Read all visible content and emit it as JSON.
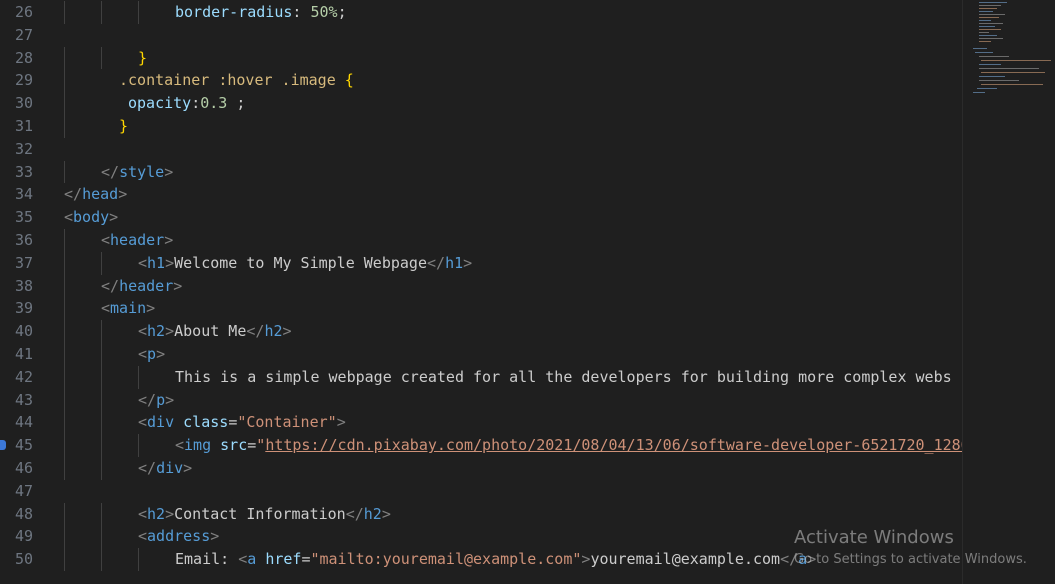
{
  "editor": {
    "lines": [
      {
        "n": "26",
        "indent": 3,
        "tokens": [
          {
            "c": "tok-prop",
            "t": "border-radius"
          },
          {
            "c": "tok-text",
            "t": ": "
          },
          {
            "c": "tok-num",
            "t": "50%"
          },
          {
            "c": "tok-text",
            "t": ";"
          }
        ]
      },
      {
        "n": "27",
        "indent": 0,
        "tokens": []
      },
      {
        "n": "28",
        "indent": 2,
        "tokens": [
          {
            "c": "tok-brace",
            "t": "}"
          }
        ]
      },
      {
        "n": "29",
        "indent": 1,
        "pad": "  ",
        "tokens": [
          {
            "c": "tok-sel",
            "t": ".container :hover .image "
          },
          {
            "c": "tok-brace",
            "t": "{"
          }
        ]
      },
      {
        "n": "30",
        "indent": 1,
        "pad": "   ",
        "tokens": [
          {
            "c": "tok-prop",
            "t": "opacity"
          },
          {
            "c": "tok-text",
            "t": ":"
          },
          {
            "c": "tok-num",
            "t": "0.3"
          },
          {
            "c": "tok-text",
            "t": " ;"
          }
        ]
      },
      {
        "n": "31",
        "indent": 1,
        "pad": "  ",
        "tokens": [
          {
            "c": "tok-brace",
            "t": "}"
          }
        ]
      },
      {
        "n": "32",
        "indent": 0,
        "tokens": []
      },
      {
        "n": "33",
        "indent": 1,
        "tokens": [
          {
            "c": "tok-bracket",
            "t": "</"
          },
          {
            "c": "tok-tag",
            "t": "style"
          },
          {
            "c": "tok-bracket",
            "t": ">"
          }
        ]
      },
      {
        "n": "34",
        "indent": 0,
        "tokens": [
          {
            "c": "tok-bracket",
            "t": "</"
          },
          {
            "c": "tok-tag",
            "t": "head"
          },
          {
            "c": "tok-bracket",
            "t": ">"
          }
        ]
      },
      {
        "n": "35",
        "indent": 0,
        "tokens": [
          {
            "c": "tok-bracket",
            "t": "<"
          },
          {
            "c": "tok-tag",
            "t": "body"
          },
          {
            "c": "tok-bracket",
            "t": ">"
          }
        ]
      },
      {
        "n": "36",
        "indent": 1,
        "tokens": [
          {
            "c": "tok-bracket",
            "t": "<"
          },
          {
            "c": "tok-tag",
            "t": "header"
          },
          {
            "c": "tok-bracket",
            "t": ">"
          }
        ]
      },
      {
        "n": "37",
        "indent": 2,
        "tokens": [
          {
            "c": "tok-bracket",
            "t": "<"
          },
          {
            "c": "tok-tag",
            "t": "h1"
          },
          {
            "c": "tok-bracket",
            "t": ">"
          },
          {
            "c": "tok-text",
            "t": "Welcome to My Simple Webpage"
          },
          {
            "c": "tok-bracket",
            "t": "</"
          },
          {
            "c": "tok-tag",
            "t": "h1"
          },
          {
            "c": "tok-bracket",
            "t": ">"
          }
        ]
      },
      {
        "n": "38",
        "indent": 1,
        "tokens": [
          {
            "c": "tok-bracket",
            "t": "</"
          },
          {
            "c": "tok-tag",
            "t": "header"
          },
          {
            "c": "tok-bracket",
            "t": ">"
          }
        ]
      },
      {
        "n": "39",
        "indent": 1,
        "tokens": [
          {
            "c": "tok-bracket",
            "t": "<"
          },
          {
            "c": "tok-tag",
            "t": "main"
          },
          {
            "c": "tok-bracket",
            "t": ">"
          }
        ]
      },
      {
        "n": "40",
        "indent": 2,
        "tokens": [
          {
            "c": "tok-bracket",
            "t": "<"
          },
          {
            "c": "tok-tag",
            "t": "h2"
          },
          {
            "c": "tok-bracket",
            "t": ">"
          },
          {
            "c": "tok-text",
            "t": "About Me"
          },
          {
            "c": "tok-bracket",
            "t": "</"
          },
          {
            "c": "tok-tag",
            "t": "h2"
          },
          {
            "c": "tok-bracket",
            "t": ">"
          }
        ]
      },
      {
        "n": "41",
        "indent": 2,
        "tokens": [
          {
            "c": "tok-bracket",
            "t": "<"
          },
          {
            "c": "tok-tag",
            "t": "p"
          },
          {
            "c": "tok-bracket",
            "t": ">"
          }
        ]
      },
      {
        "n": "42",
        "indent": 3,
        "tokens": [
          {
            "c": "tok-text",
            "t": "This is a simple webpage created for all the developers for building more complex webs"
          }
        ]
      },
      {
        "n": "43",
        "indent": 2,
        "tokens": [
          {
            "c": "tok-bracket",
            "t": "</"
          },
          {
            "c": "tok-tag",
            "t": "p"
          },
          {
            "c": "tok-bracket",
            "t": ">"
          }
        ]
      },
      {
        "n": "44",
        "indent": 2,
        "tokens": [
          {
            "c": "tok-bracket",
            "t": "<"
          },
          {
            "c": "tok-tag",
            "t": "div"
          },
          {
            "c": "tok-text",
            "t": " "
          },
          {
            "c": "tok-attr",
            "t": "class"
          },
          {
            "c": "tok-text",
            "t": "="
          },
          {
            "c": "tok-str",
            "t": "\"Container\""
          },
          {
            "c": "tok-bracket",
            "t": ">"
          }
        ]
      },
      {
        "n": "45",
        "indent": 3,
        "tokens": [
          {
            "c": "tok-bracket",
            "t": "<"
          },
          {
            "c": "tok-tag",
            "t": "img"
          },
          {
            "c": "tok-text",
            "t": " "
          },
          {
            "c": "tok-attr",
            "t": "src"
          },
          {
            "c": "tok-text",
            "t": "="
          },
          {
            "c": "tok-str",
            "t": "\""
          },
          {
            "c": "tok-link",
            "t": "https://cdn.pixabay.com/photo/2021/08/04/13/06/software-developer-6521720_1280"
          }
        ]
      },
      {
        "n": "46",
        "indent": 2,
        "tokens": [
          {
            "c": "tok-bracket",
            "t": "</"
          },
          {
            "c": "tok-tag",
            "t": "div"
          },
          {
            "c": "tok-bracket",
            "t": ">"
          }
        ]
      },
      {
        "n": "47",
        "indent": 0,
        "tokens": []
      },
      {
        "n": "48",
        "indent": 2,
        "tokens": [
          {
            "c": "tok-bracket",
            "t": "<"
          },
          {
            "c": "tok-tag",
            "t": "h2"
          },
          {
            "c": "tok-bracket",
            "t": ">"
          },
          {
            "c": "tok-text",
            "t": "Contact Information"
          },
          {
            "c": "tok-bracket",
            "t": "</"
          },
          {
            "c": "tok-tag",
            "t": "h2"
          },
          {
            "c": "tok-bracket",
            "t": ">"
          }
        ]
      },
      {
        "n": "49",
        "indent": 2,
        "tokens": [
          {
            "c": "tok-bracket",
            "t": "<"
          },
          {
            "c": "tok-tag",
            "t": "address"
          },
          {
            "c": "tok-bracket",
            "t": ">"
          }
        ]
      },
      {
        "n": "50",
        "indent": 3,
        "tokens": [
          {
            "c": "tok-text",
            "t": "Email: "
          },
          {
            "c": "tok-bracket",
            "t": "<"
          },
          {
            "c": "tok-tag",
            "t": "a"
          },
          {
            "c": "tok-text",
            "t": " "
          },
          {
            "c": "tok-attr",
            "t": "href"
          },
          {
            "c": "tok-text",
            "t": "="
          },
          {
            "c": "tok-str",
            "t": "\"mailto:youremail@example.com\""
          },
          {
            "c": "tok-bracket",
            "t": ">"
          },
          {
            "c": "tok-text",
            "t": "youremail@example.com"
          },
          {
            "c": "tok-bracket",
            "t": "</"
          },
          {
            "c": "tok-tag",
            "t": "a"
          },
          {
            "c": "tok-bracket",
            "t": ">"
          }
        ]
      }
    ]
  },
  "watermark": {
    "title": "Activate Windows",
    "subtitle": "Go to Settings to activate Windows."
  },
  "colors": {
    "background": "#1f1f1f",
    "line_number": "#6e7681",
    "tag": "#569cd6",
    "attribute": "#9cdcfe",
    "string": "#ce9178",
    "number": "#b5cea8",
    "selector": "#d7ba7d",
    "brace": "#ffd700"
  }
}
